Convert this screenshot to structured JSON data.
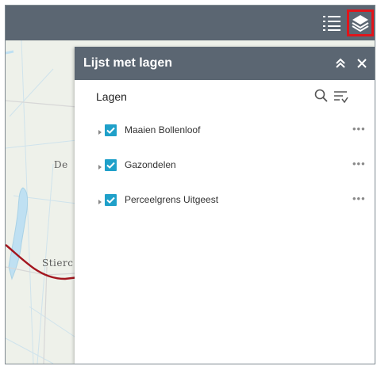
{
  "map": {
    "labels": [
      {
        "name": "map-label-de",
        "text": "De"
      },
      {
        "name": "map-label-stierop",
        "text": "Stierc"
      }
    ]
  },
  "toolbar": {
    "legend_icon": "legend-list-icon",
    "layers_icon": "layers-stack-icon"
  },
  "panel": {
    "title": "Lijst met lagen",
    "collapse_glyph": "»",
    "close_glyph": "✕",
    "section_label": "Lagen",
    "layers": [
      {
        "label": "Maaien Bollenloof",
        "checked": true
      },
      {
        "label": "Gazondelen",
        "checked": true
      },
      {
        "label": "Perceelgrens Uitgeest",
        "checked": true
      }
    ],
    "more_glyph": "•••"
  },
  "colors": {
    "header": "#5b6672",
    "checkbox": "#1fa0c9",
    "highlight": "#e0151b",
    "route": "#a3161f",
    "water": "#bfe0f2"
  }
}
